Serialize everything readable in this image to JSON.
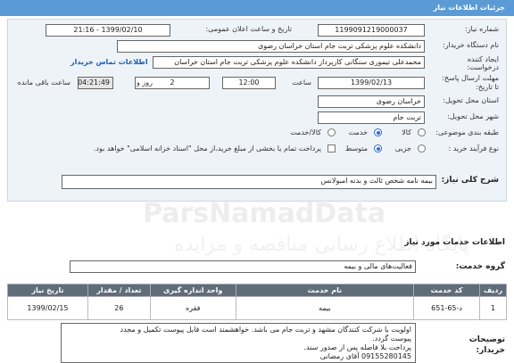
{
  "header": {
    "title": "جزئیات اطلاعات نیاز"
  },
  "fields": {
    "need_number_label": "شماره نیاز:",
    "need_number": "1199091219000037",
    "announce_label": "تاریخ و ساعت اعلان عمومی:",
    "announce_value": "1399/02/10 - 21:16",
    "buyer_label": "نام دستگاه خریدار:",
    "buyer_value": "دانشکده علوم پزشکی تربت جام استان خراسان رضوی",
    "creator_label_1": "ایجاد کننده",
    "creator_label_2": "درخواست:",
    "creator_value": "محمدعلی تیموری سنگانی کارپرداز دانشکده علوم پزشکی تربت جام استان خراسان",
    "contact_link": "اطلاعات تماس خریدار",
    "deadline_label_1": "مهلت ارسال پاسخ:",
    "deadline_label_2": "تا تاریخ:",
    "deadline_date": "1399/02/13",
    "time_label": "ساعت",
    "deadline_time": "12:00",
    "days_value": "2",
    "days_label": "روز و",
    "remaining_time": "04:21:49",
    "remaining_label": "ساعت باقی مانده",
    "province_label": "استان محل تحویل:",
    "province_value": "خراسان رضوی",
    "city_label": "شهر محل تحویل:",
    "city_value": "تربت جام",
    "category_label": "طبقه بندی موضوعی:",
    "cat_goods": "کالا",
    "cat_service": "خدمت",
    "cat_goods_service": "کالا/خدمت",
    "process_label": "نوع فرآیند خرید :",
    "proc_partial": "جزیی",
    "proc_medium": "متوسط",
    "payment_note": "پرداخت تمام یا بخشی از مبلغ خرید،از محل \"اسناد خزانه اسلامی\" خواهد بود."
  },
  "summary": {
    "label": "شرح کلی نیاز:",
    "value": "بیمه نامه شخص ثالث و بدنه امبولانس"
  },
  "services_section": {
    "title": "اطلاعات خدمات مورد نیاز"
  },
  "service_group": {
    "label": "گروه خدمت:",
    "value": "فعالیت‌های مالی و بیمه"
  },
  "table": {
    "headers": [
      "ردیف",
      "کد خدمت",
      "نام خدمت",
      "واحد اندازه گیری",
      "تعداد / مقدار",
      "تاریخ نیاز"
    ],
    "rows": [
      [
        "1",
        "د-65-651",
        "بیمه",
        "فقره",
        "26",
        "1399/02/15"
      ]
    ]
  },
  "buyer_notes": {
    "label_1": "توضیحات",
    "label_2": "خریدار:",
    "lines": [
      "اولویت با شرکت کنندگان مشهد و تربت جام می باشد. خواهشمند است فایل پیوست تکمیل و مجدد",
      "پیوست  گردد.",
      "پرداخت بلا فاصله پس از صدور سند.",
      "09155280145 آقای رمضانی"
    ]
  },
  "watermark": {
    "line1": "ParsNamadData",
    "line2": "پایگاه اطلاع رسانی مناقصه و مزایده"
  }
}
